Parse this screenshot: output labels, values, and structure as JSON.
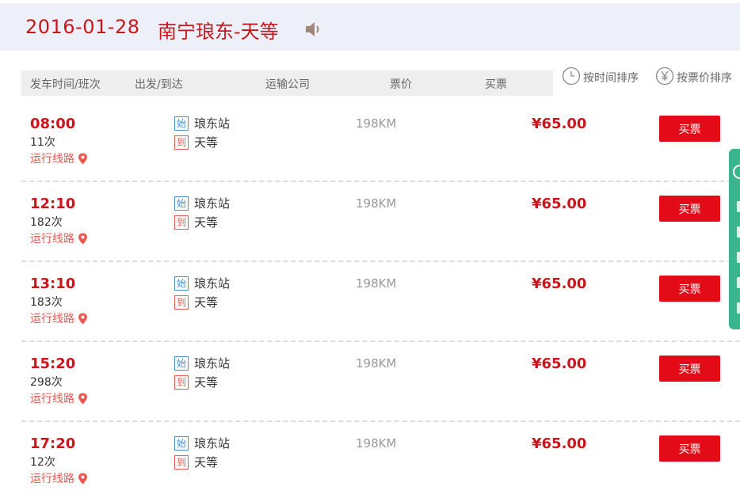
{
  "header": {
    "date": "2016-01-28",
    "route": "南宁琅东-天等",
    "speaker_icon": "speaker-icon"
  },
  "table_header": {
    "departure_time": "发车时间/班次",
    "depart_arrive": "出发/到达",
    "company": "运输公司",
    "fare": "票价",
    "buy": "买票"
  },
  "sort": {
    "by_time": "按时间排序",
    "by_price": "按票价排序"
  },
  "labels": {
    "route_link": "运行线路",
    "start_tag": "始",
    "end_tag": "到",
    "buy_button": "买票"
  },
  "trips": [
    {
      "time": "08:00",
      "trip": "11次",
      "from": "琅东站",
      "to": "天等",
      "distance": "198KM",
      "price": "¥65.00"
    },
    {
      "time": "12:10",
      "trip": "182次",
      "from": "琅东站",
      "to": "天等",
      "distance": "198KM",
      "price": "¥65.00"
    },
    {
      "time": "13:10",
      "trip": "183次",
      "from": "琅东站",
      "to": "天等",
      "distance": "198KM",
      "price": "¥65.00"
    },
    {
      "time": "15:20",
      "trip": "298次",
      "from": "琅东站",
      "to": "天等",
      "distance": "198KM",
      "price": "¥65.00"
    },
    {
      "time": "17:20",
      "trip": "12次",
      "from": "琅东站",
      "to": "天等",
      "distance": "198KM",
      "price": "¥65.00"
    }
  ],
  "colors": {
    "accent": "#c8161d",
    "buy_button": "#e40b18",
    "side_tab": "#3bb58e"
  }
}
